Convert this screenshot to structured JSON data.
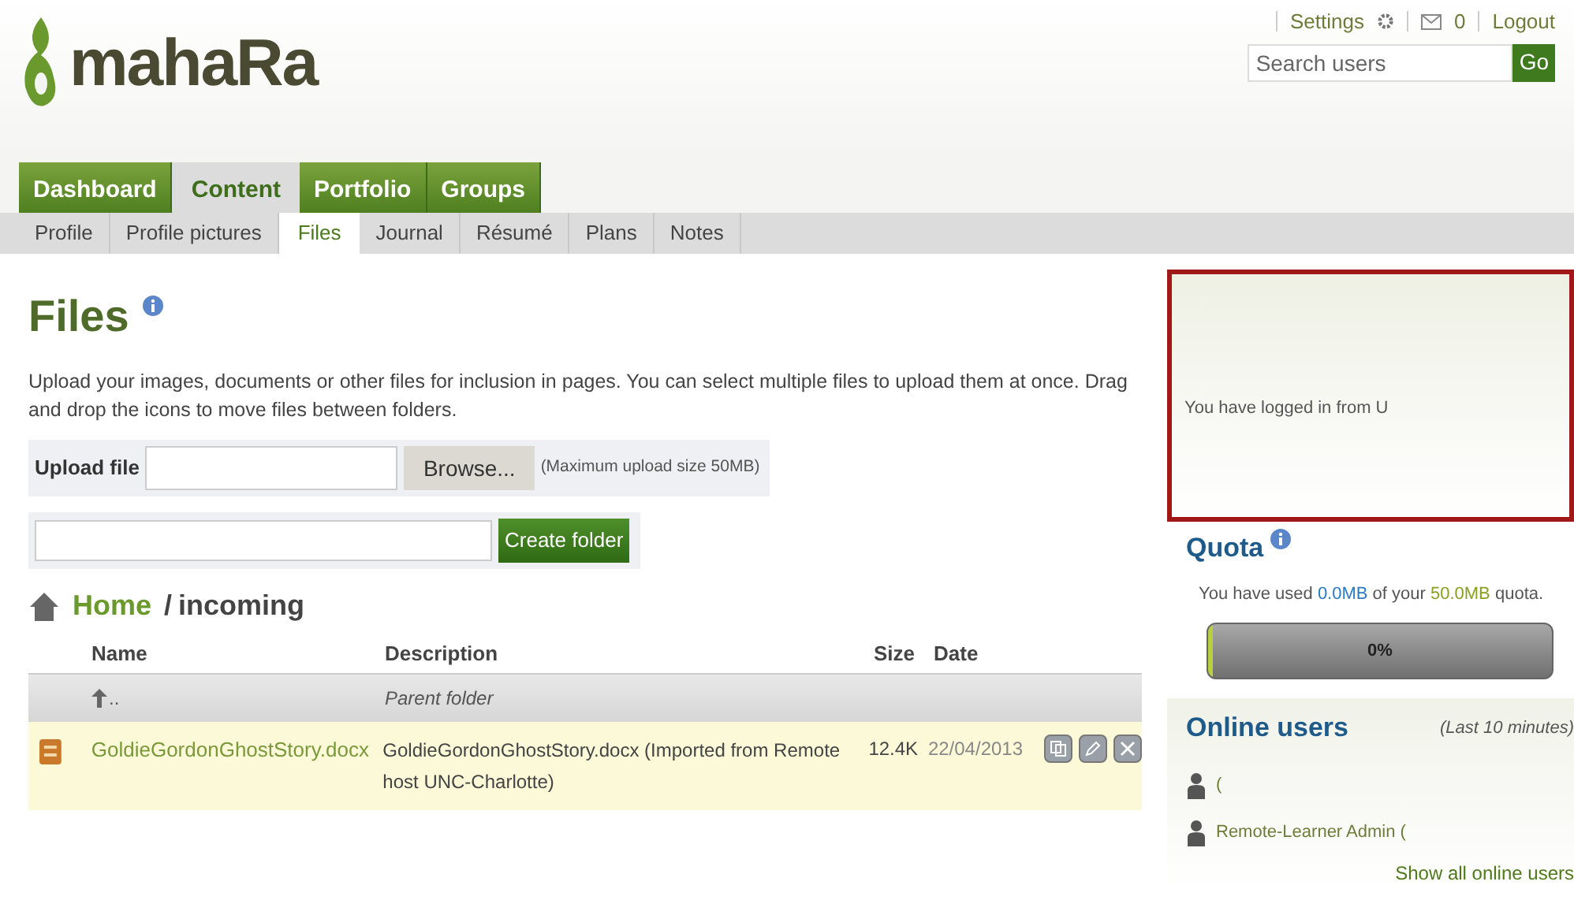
{
  "header": {
    "logo_text": "mahaRa",
    "links": {
      "settings": "Settings",
      "messages": "0",
      "logout": "Logout"
    },
    "search": {
      "placeholder": "Search users",
      "button": "Go"
    }
  },
  "nav": [
    {
      "label": "Dashboard",
      "selected": false
    },
    {
      "label": "Content",
      "selected": true
    },
    {
      "label": "Portfolio",
      "selected": false
    },
    {
      "label": "Groups",
      "selected": false
    }
  ],
  "subnav": [
    {
      "label": "Profile",
      "selected": false
    },
    {
      "label": "Profile pictures",
      "selected": false
    },
    {
      "label": "Files",
      "selected": true
    },
    {
      "label": "Journal",
      "selected": false
    },
    {
      "label": "Résumé",
      "selected": false
    },
    {
      "label": "Plans",
      "selected": false
    },
    {
      "label": "Notes",
      "selected": false
    }
  ],
  "page": {
    "title": "Files",
    "description": "Upload your images, documents or other files for inclusion in pages. You can select multiple files to upload them at once. Drag and drop the icons to move files between folders.",
    "upload_label": "Upload file",
    "browse": "Browse...",
    "max_size": "(Maximum upload size 50MB)",
    "create_folder": "Create folder"
  },
  "breadcrumb": {
    "home": "Home",
    "separator": "/",
    "current": "incoming"
  },
  "table": {
    "columns": [
      "Name",
      "Description",
      "Size",
      "Date"
    ],
    "rows": [
      {
        "kind": "parent",
        "name": "..",
        "description": "Parent folder"
      },
      {
        "kind": "file",
        "name": "GoldieGordonGhostStory.docx",
        "description": "GoldieGordonGhostStory.docx (Imported from Remote host UNC-Charlotte)",
        "size": "12.4K",
        "date": "22/04/2013"
      }
    ]
  },
  "sidebar": {
    "login_notice": "You have logged in from U",
    "quota": {
      "title": "Quota",
      "prefix": "You have used ",
      "used": "0.0MB",
      "middle": " of your ",
      "total": "50.0MB",
      "suffix": " quota.",
      "level": 0,
      "reading": "0%"
    },
    "online": {
      "title": "Online users",
      "period": "(Last 10 minutes)",
      "users": [
        "(",
        "Remote-Learner Admin ("
      ],
      "show_all": "Show all online users"
    }
  }
}
